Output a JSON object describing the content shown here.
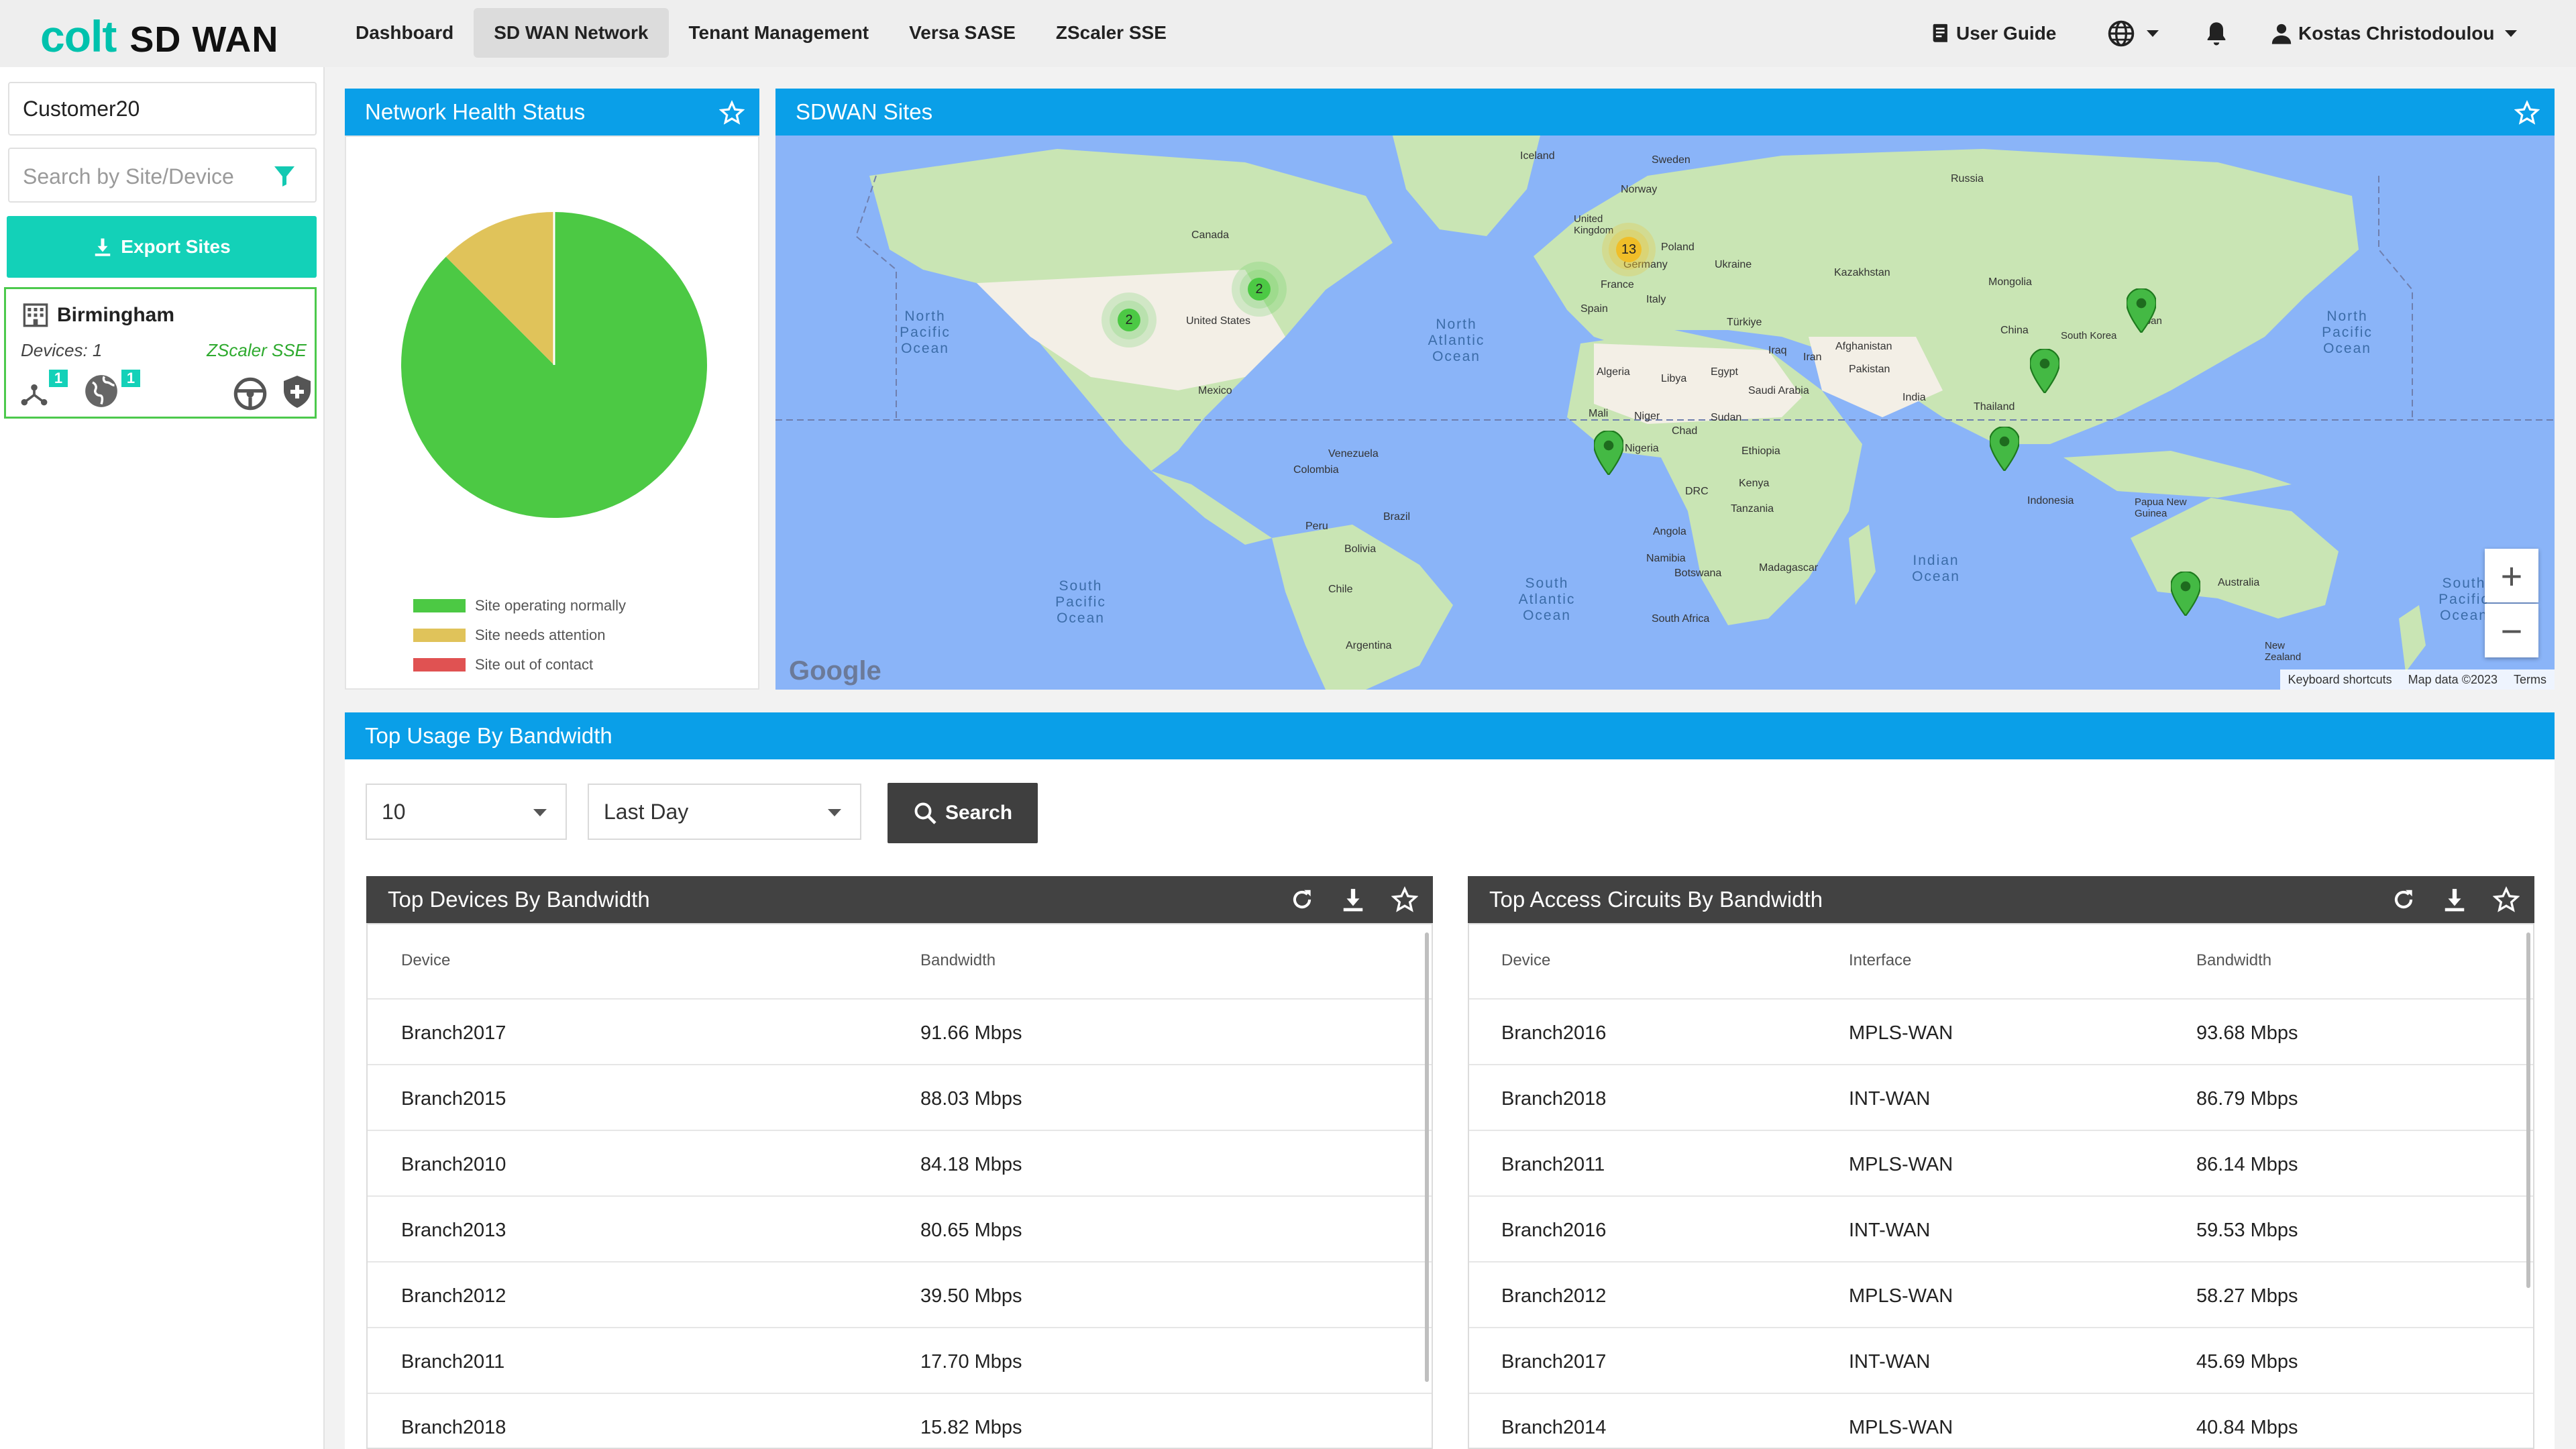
{
  "brand": {
    "logo_colt": "colt",
    "logo_product": "SD WAN",
    "accent": "#00c2ad"
  },
  "nav": {
    "items": [
      {
        "label": "Dashboard",
        "active": false
      },
      {
        "label": "SD WAN Network",
        "active": true
      },
      {
        "label": "Tenant Management",
        "active": false
      },
      {
        "label": "Versa SASE",
        "active": false
      },
      {
        "label": "ZScaler SSE",
        "active": false
      }
    ]
  },
  "topright": {
    "user_guide": "User Guide",
    "user_name": "Kostas Christodoulou"
  },
  "sidebar": {
    "customer": "Customer20",
    "search_placeholder": "Search by Site/Device",
    "export_label": "Export Sites",
    "site": {
      "name": "Birmingham",
      "devices": "Devices: 1",
      "service": "ZScaler SSE",
      "badge_topology": "1",
      "badge_globe": "1"
    }
  },
  "health": {
    "title": "Network Health Status",
    "legend": [
      {
        "label": "Site operating normally",
        "color": "#4cc944"
      },
      {
        "label": "Site needs attention",
        "color": "#e0c35a"
      },
      {
        "label": "Site out of contact",
        "color": "#e05252"
      }
    ],
    "fractions": {
      "normal": 0.875,
      "attention": 0.125,
      "out_of_contact": 0
    }
  },
  "map": {
    "title": "SDWAN Sites",
    "cluster_labels": [
      "2",
      "2",
      "13"
    ],
    "ocean_labels": {
      "north_pacific": "North Pacific Ocean",
      "north_atlantic": "North Atlantic Ocean",
      "south_pacific": "South Pacific Ocean",
      "south_atlantic": "South Atlantic Ocean",
      "indian": "Indian Ocean",
      "north_pacific_right": "North Pacific Ocean",
      "south_pacific_right": "South Pacific Ocean"
    },
    "country_labels": [
      "Canada",
      "United States",
      "Mexico",
      "Venezuela",
      "Colombia",
      "Peru",
      "Brazil",
      "Bolivia",
      "Chile",
      "Argentina",
      "Iceland",
      "Sweden",
      "Norway",
      "United Kingdom",
      "Poland",
      "Germany",
      "Ukraine",
      "France",
      "Italy",
      "Spain",
      "Kazakhstan",
      "Mongolia",
      "Russia",
      "China",
      "South Korea",
      "Japan",
      "Türkiye",
      "Iraq",
      "Iran",
      "Afghanistan",
      "Pakistan",
      "India",
      "Thailand",
      "Algeria",
      "Libya",
      "Egypt",
      "Saudi Arabia",
      "Mali",
      "Niger",
      "Chad",
      "Sudan",
      "Nigeria",
      "Ethiopia",
      "Kenya",
      "DRC",
      "Tanzania",
      "Angola",
      "Namibia",
      "Botswana",
      "South Africa",
      "Madagascar",
      "Indonesia",
      "Papua New Guinea",
      "Australia",
      "New Zealand"
    ],
    "attribution": {
      "shortcuts": "Keyboard shortcuts",
      "data": "Map data ©2023",
      "terms": "Terms"
    },
    "google": "Google"
  },
  "usage": {
    "title": "Top Usage By Bandwidth",
    "count_value": "10",
    "period_value": "Last Day",
    "search_label": "Search"
  },
  "devices_table": {
    "title": "Top Devices By Bandwidth",
    "columns": [
      "Device",
      "Bandwidth"
    ],
    "rows": [
      [
        "Branch2017",
        "91.66 Mbps"
      ],
      [
        "Branch2015",
        "88.03 Mbps"
      ],
      [
        "Branch2010",
        "84.18 Mbps"
      ],
      [
        "Branch2013",
        "80.65 Mbps"
      ],
      [
        "Branch2012",
        "39.50 Mbps"
      ],
      [
        "Branch2011",
        "17.70 Mbps"
      ],
      [
        "Branch2018",
        "15.82 Mbps"
      ]
    ]
  },
  "circuits_table": {
    "title": "Top Access Circuits By Bandwidth",
    "columns": [
      "Device",
      "Interface",
      "Bandwidth"
    ],
    "rows": [
      [
        "Branch2016",
        "MPLS-WAN",
        "93.68 Mbps"
      ],
      [
        "Branch2018",
        "INT-WAN",
        "86.79 Mbps"
      ],
      [
        "Branch2011",
        "MPLS-WAN",
        "86.14 Mbps"
      ],
      [
        "Branch2016",
        "INT-WAN",
        "59.53 Mbps"
      ],
      [
        "Branch2012",
        "MPLS-WAN",
        "58.27 Mbps"
      ],
      [
        "Branch2017",
        "INT-WAN",
        "45.69 Mbps"
      ],
      [
        "Branch2014",
        "MPLS-WAN",
        "40.84 Mbps"
      ]
    ]
  }
}
